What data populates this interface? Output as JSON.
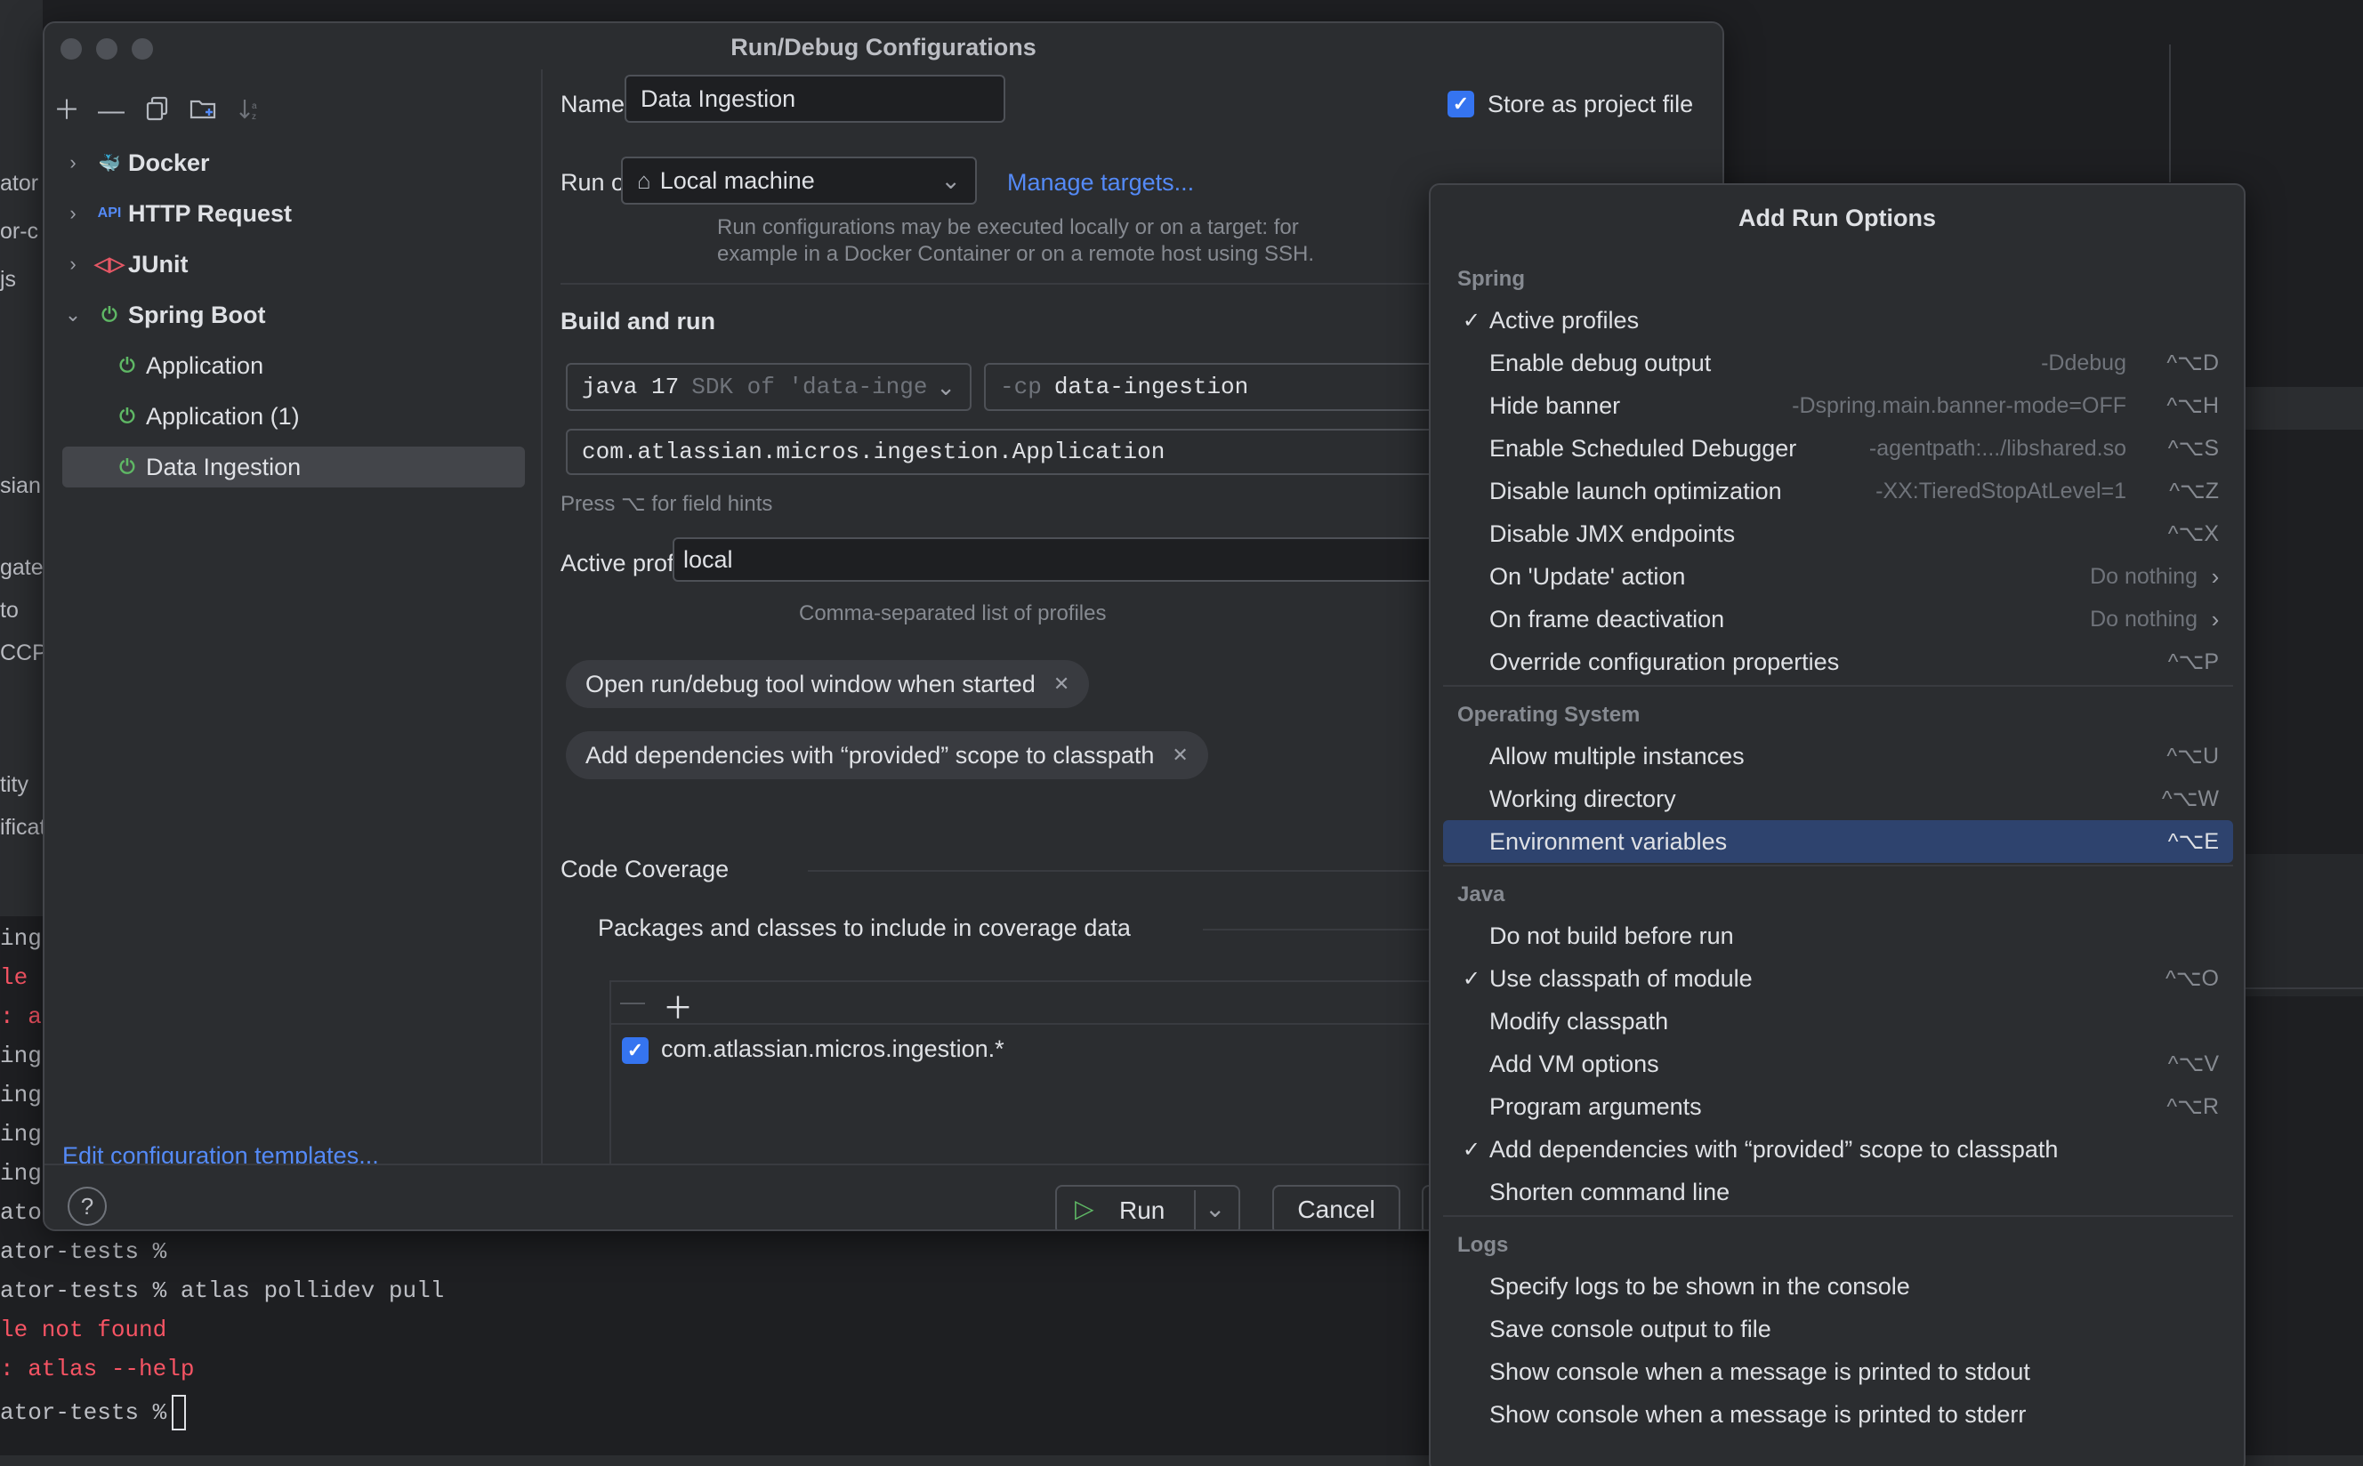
{
  "background": {
    "left_fragments": [
      "ator",
      "or-c",
      "js",
      "sian.",
      "gate",
      "to",
      "CCP(",
      "tity",
      "ificat"
    ],
    "terminal": [
      {
        "text": "inge",
        "err": false
      },
      {
        "text": "le",
        "err": true
      },
      {
        "text": ": a",
        "err": true
      },
      {
        "text": "inge",
        "err": false
      },
      {
        "text": "inge",
        "err": false
      },
      {
        "text": "inge",
        "err": false
      },
      {
        "text": "inge",
        "err": false
      },
      {
        "text": "ator",
        "err": false
      },
      {
        "text": "ator-tests %",
        "err": false
      },
      {
        "text": "ator-tests % atlas pollidev pull",
        "err": false
      },
      {
        "text": "le not found",
        "err": true
      },
      {
        "text": ": atlas --help",
        "err": true
      },
      {
        "text": "ator-tests %",
        "err": false
      }
    ]
  },
  "dialog": {
    "title": "Run/Debug Configurations",
    "tree": [
      {
        "label": "Docker",
        "icon": "docker-icon",
        "expanded": false,
        "bold": true
      },
      {
        "label": "HTTP Request",
        "icon": "api-icon",
        "expanded": false,
        "bold": true
      },
      {
        "label": "JUnit",
        "icon": "junit-icon",
        "expanded": false,
        "bold": true
      },
      {
        "label": "Spring Boot",
        "icon": "spring-boot-icon",
        "expanded": true,
        "bold": true
      },
      {
        "label": "Application",
        "icon": "spring-boot-icon",
        "child": true
      },
      {
        "label": "Application (1)",
        "icon": "spring-boot-icon",
        "child": true
      },
      {
        "label": "Data Ingestion",
        "icon": "spring-boot-icon",
        "child": true,
        "selected": true
      }
    ],
    "edit_templates": "Edit configuration templates...",
    "name_label": "Name:",
    "name_value": "Data Ingestion",
    "store_label": "Store as project file",
    "run_on_label": "Run on:",
    "run_on_value": "Local machine",
    "manage_targets": "Manage targets...",
    "run_on_hint_1": "Run configurations may be executed locally or on a target: for",
    "run_on_hint_2": "example in a Docker Container or on a remote host using SSH.",
    "build_and_run": "Build and run",
    "java_prefix": "java 17",
    "java_sdk": "SDK of 'data-inge",
    "cp_prefix": "-cp",
    "cp_value": "data-ingestion",
    "main_class": "com.atlassian.micros.ingestion.Application",
    "field_hints": "Press ⌥ for field hints",
    "profiles_label": "Active profiles:",
    "profiles_value": "local",
    "profiles_hint": "Comma-separated list of profiles",
    "chip_1": "Open run/debug tool window when started",
    "chip_2": "Add dependencies with “provided” scope to classpath",
    "coverage_section": "Code Coverage",
    "coverage_sub": "Packages and classes to include in coverage data",
    "coverage_item": "com.atlassian.micros.ingestion.*",
    "run_button": "Run",
    "cancel_button": "Cancel",
    "help": "?"
  },
  "popup": {
    "title": "Add Run Options",
    "groups": [
      {
        "name": "Spring",
        "items": [
          {
            "label": "Active profiles",
            "checked": true,
            "hint": "",
            "shortcut": ""
          },
          {
            "label": "Enable debug output",
            "hint": "-Ddebug",
            "shortcut": "^⌥D"
          },
          {
            "label": "Hide banner",
            "hint": "-Dspring.main.banner-mode=OFF",
            "shortcut": "^⌥H"
          },
          {
            "label": "Enable Scheduled Debugger",
            "hint": "-agentpath:.../libshared.so",
            "shortcut": "^⌥S"
          },
          {
            "label": "Disable launch optimization",
            "hint": "-XX:TieredStopAtLevel=1",
            "shortcut": "^⌥Z"
          },
          {
            "label": "Disable JMX endpoints",
            "hint": "",
            "shortcut": "^⌥X"
          },
          {
            "label": "On 'Update' action",
            "hint": "Do nothing",
            "submenu": true
          },
          {
            "label": "On frame deactivation",
            "hint": "Do nothing",
            "submenu": true
          },
          {
            "label": "Override configuration properties",
            "hint": "",
            "shortcut": "^⌥P"
          }
        ]
      },
      {
        "name": "Operating System",
        "items": [
          {
            "label": "Allow multiple instances",
            "shortcut": "^⌥U"
          },
          {
            "label": "Working directory",
            "shortcut": "^⌥W"
          },
          {
            "label": "Environment variables",
            "shortcut": "^⌥E",
            "selected": true
          }
        ]
      },
      {
        "name": "Java",
        "items": [
          {
            "label": "Do not build before run"
          },
          {
            "label": "Use classpath of module",
            "checked": true,
            "shortcut": "^⌥O"
          },
          {
            "label": "Modify classpath"
          },
          {
            "label": "Add VM options",
            "shortcut": "^⌥V"
          },
          {
            "label": "Program arguments",
            "shortcut": "^⌥R"
          },
          {
            "label": "Add dependencies with “provided” scope to classpath",
            "checked": true
          },
          {
            "label": "Shorten command line"
          }
        ]
      },
      {
        "name": "Logs",
        "items": [
          {
            "label": "Specify logs to be shown in the console"
          },
          {
            "label": "Save console output to file"
          },
          {
            "label": "Show console when a message is printed to stdout"
          },
          {
            "label": "Show console when a message is printed to stderr"
          }
        ]
      }
    ]
  },
  "colors": {
    "accent": "#3574f0",
    "link": "#548af7",
    "selected_row": "#2e436e",
    "error": "#f75464"
  }
}
